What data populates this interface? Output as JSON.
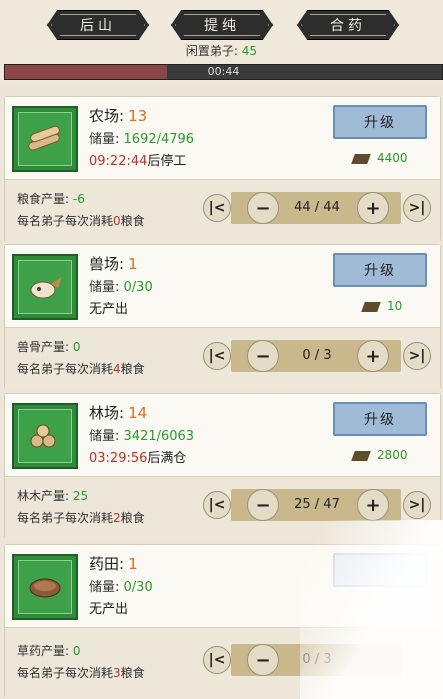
{
  "tabs": [
    "后山",
    "提纯",
    "合药"
  ],
  "idle": {
    "label": "闲置弟子:",
    "count": "45"
  },
  "timer": {
    "text": "00:44",
    "progress": 0.37
  },
  "buildings": [
    {
      "name": "农场:",
      "level": "13",
      "stock_label": "储量:",
      "stock_value": "1692/4796",
      "status_time": "09:22:44",
      "status_suffix": "后停工",
      "upgrade_label": "升级",
      "cost": "4400",
      "output_label": "粮食产量:",
      "output_value": "-6",
      "consume_prefix": "每名弟子每次消耗",
      "consume_value": "0",
      "consume_suffix": "粮食",
      "workers": "44 / 44",
      "icon": "logs-icon"
    },
    {
      "name": "兽场:",
      "level": "1",
      "stock_label": "储量:",
      "stock_value": "0/30",
      "status_time": "",
      "status_suffix": "无产出",
      "upgrade_label": "升级",
      "cost": "10",
      "output_label": "兽骨产量:",
      "output_value": "0",
      "consume_prefix": "每名弟子每次消耗",
      "consume_value": "4",
      "consume_suffix": "粮食",
      "workers": "0 / 3",
      "icon": "beast-skull-icon"
    },
    {
      "name": "林场:",
      "level": "14",
      "stock_label": "储量:",
      "stock_value": "3421/6063",
      "status_time": "03:29:56",
      "status_suffix": "后满仓",
      "upgrade_label": "升级",
      "cost": "2800",
      "output_label": "林木产量:",
      "output_value": "25",
      "consume_prefix": "每名弟子每次消耗",
      "consume_value": "2",
      "consume_suffix": "粮食",
      "workers": "25 / 47",
      "icon": "wood-logs-icon"
    },
    {
      "name": "药田:",
      "level": "1",
      "stock_label": "储量:",
      "stock_value": "0/30",
      "status_time": "",
      "status_suffix": "无产出",
      "upgrade_label": "",
      "cost": "",
      "output_label": "草药产量:",
      "output_value": "0",
      "consume_prefix": "每名弟子每次消耗",
      "consume_value": "3",
      "consume_suffix": "粮食",
      "workers": "0 / 3",
      "icon": "herb-bowl-icon"
    }
  ]
}
